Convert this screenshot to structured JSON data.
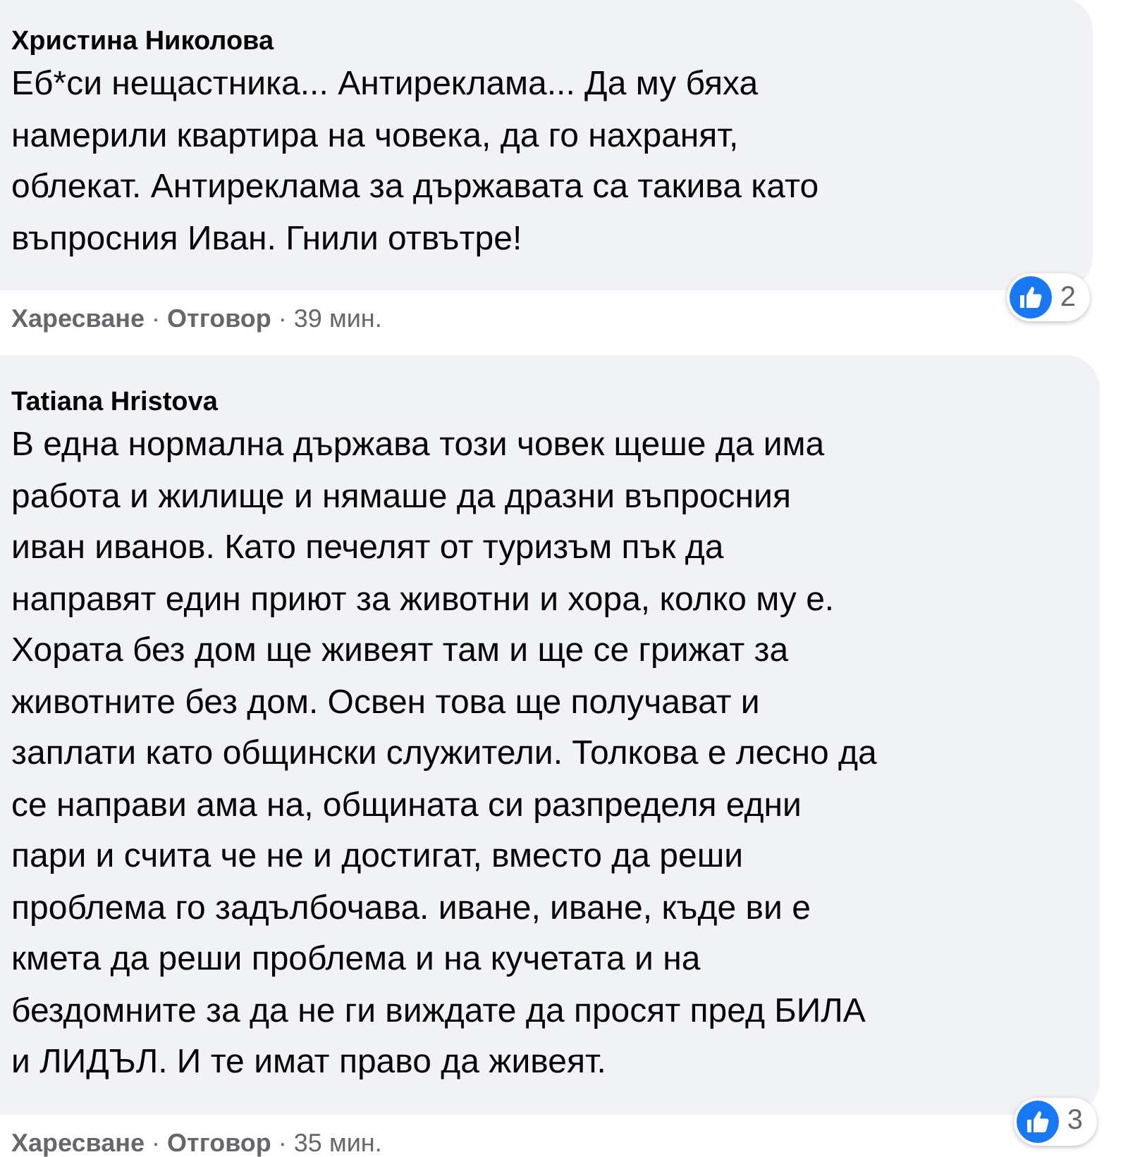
{
  "comments": [
    {
      "author": "Христина Николова",
      "lines": [
        "Еб*си нещастника... Антиреклама... Да му бяха",
        "намерили квартира на човека, да го нахранят,",
        "облекат. Антиреклама за държавата са такива като",
        "въпросния Иван. Гнили отвътре!"
      ],
      "reactions": "2",
      "separator": "·",
      "actions": [
        "Харесване",
        "Отговор"
      ],
      "time": "39 мин."
    },
    {
      "author": "Tatiana Hristova",
      "lines": [
        "В една нормална държава този човек щеше да има",
        "работа и жилище и нямаше да дразни въпросния",
        "иван иванов. Като печелят от туризъм пък да",
        "направят един приют за животни и хора, колко му е.",
        "Хората без дом ще живеят там и ще се грижат за",
        "животните без дом. Освен това ще получават и",
        "заплати като общински служители. Толкова е лесно да",
        "се направи ама на, общината си разпределя едни",
        "пари и счита че не и достигат, вместо да реши",
        "проблема го задълбочава. иване, иване, къде ви е",
        "кмета да реши проблема и на кучетата и на",
        "бездомните за да не ги виждате да просят пред БИЛА",
        "и ЛИДЪЛ. И те имат право да живеят."
      ],
      "reactions": "3",
      "separator": "·",
      "actions": [
        "Харесване",
        "Отговор"
      ],
      "time": "35 мин."
    }
  ]
}
